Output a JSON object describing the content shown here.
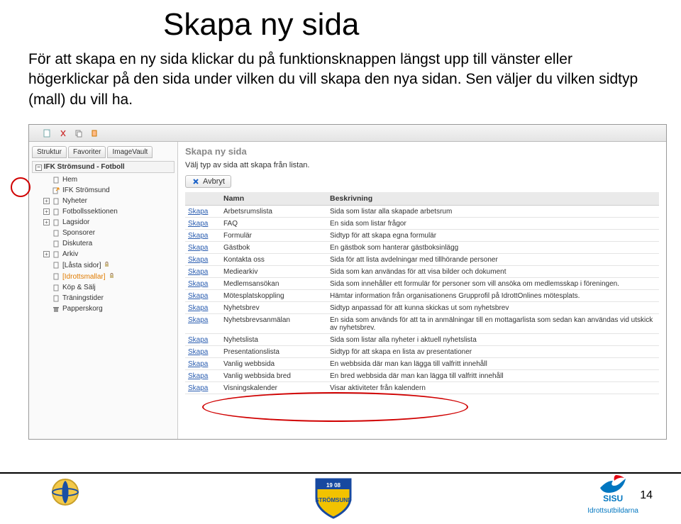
{
  "slide": {
    "title": "Skapa ny sida",
    "body": "För att skapa en ny sida klickar du på funktionsknappen längst upp till vänster eller högerklickar på den sida under vilken du vill skapa den nya sidan. Sen väljer du vilken sidtyp (mall) du vill ha.",
    "page_number": "14"
  },
  "app": {
    "tabs": [
      "Struktur",
      "Favoriter",
      "ImageVault"
    ],
    "tree_root": "IFK Strömsund - Fotboll",
    "tree": [
      {
        "label": "Hem",
        "icon": "page",
        "leaf": true
      },
      {
        "label": "IFK Strömsund",
        "icon": "page-ext",
        "leaf": true
      },
      {
        "label": "Nyheter",
        "expand": "+",
        "icon": "page"
      },
      {
        "label": "Fotbollssektionen",
        "expand": "+"
      },
      {
        "label": "Lagsidor",
        "expand": "+"
      },
      {
        "label": "Sponsorer",
        "leaf": true
      },
      {
        "label": "Diskutera",
        "leaf": true
      },
      {
        "label": "Arkiv",
        "expand": "+"
      },
      {
        "label": "[Låsta sidor]",
        "leaf": true,
        "locked": true
      },
      {
        "label": "[Idrottsmallar]",
        "leaf": true,
        "locked": true,
        "orange": true
      },
      {
        "label": "Köp & Sälj",
        "leaf": true,
        "icon": "page"
      },
      {
        "label": "Träningstider",
        "leaf": true
      },
      {
        "label": "Papperskorg",
        "leaf": true,
        "icon": "trash"
      }
    ],
    "main_heading": "Skapa ny sida",
    "main_subtext": "Välj typ av sida att skapa från listan.",
    "cancel_label": "Avbryt",
    "table_headers": [
      "",
      "Namn",
      "Beskrivning"
    ],
    "rows": [
      {
        "name": "Arbetsrumslista",
        "desc": "Sida som listar alla skapade arbetsrum"
      },
      {
        "name": "FAQ",
        "desc": "En sida som listar frågor"
      },
      {
        "name": "Formulär",
        "desc": "Sidtyp för att skapa egna formulär"
      },
      {
        "name": "Gästbok",
        "desc": "En gästbok som hanterar gästboksinlägg"
      },
      {
        "name": "Kontakta oss",
        "desc": "Sida för att lista avdelningar med tillhörande personer"
      },
      {
        "name": "Mediearkiv",
        "desc": "Sida som kan användas för att visa bilder och dokument"
      },
      {
        "name": "Medlemsansökan",
        "desc": "Sida som innehåller ett formulär för personer som vill ansöka om medlemsskap i föreningen."
      },
      {
        "name": "Mötesplatskoppling",
        "desc": "Hämtar information från organisationens Grupprofil på IdrottOnlines mötesplats."
      },
      {
        "name": "Nyhetsbrev",
        "desc": "Sidtyp anpassad för att kunna skickas ut som nyhetsbrev"
      },
      {
        "name": "Nyhetsbrevsanmälan",
        "desc": "En sida som används för att ta in anmälningar till en mottagarlista som sedan kan användas vid utskick av nyhetsbrev."
      },
      {
        "name": "Nyhetslista",
        "desc": "Sida som listar alla nyheter i aktuell nyhetslista"
      },
      {
        "name": "Presentationslista",
        "desc": "Sidtyp för att skapa en lista av presentationer"
      },
      {
        "name": "Vanlig webbsida",
        "desc": "En webbsida där man kan lägga till valfritt innehåll"
      },
      {
        "name": "Vanlig webbsida bred",
        "desc": "En bred webbsida där man kan lägga till valfritt innehåll"
      },
      {
        "name": "Visningskalender",
        "desc": "Visar aktiviteter från kalendern"
      }
    ],
    "create_link": "Skapa"
  },
  "logos": {
    "sisu": "SISU",
    "sisu_sub": "Idrottsutbildarna"
  }
}
